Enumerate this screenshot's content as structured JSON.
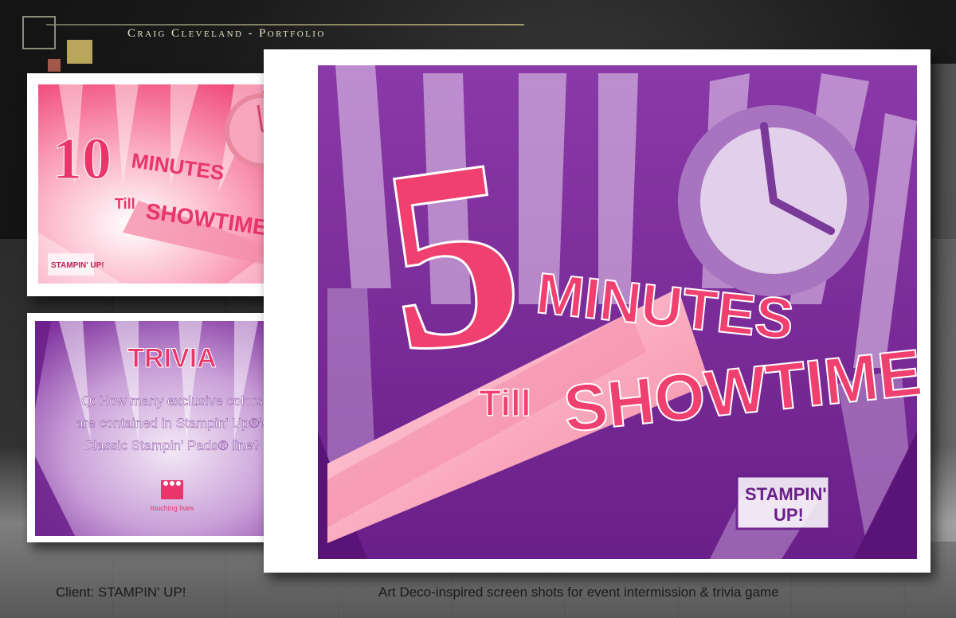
{
  "header": {
    "title": "Craig Cleveland - Portfolio"
  },
  "slides": {
    "countdown_small": {
      "number": "10",
      "word1": "MINUTES",
      "word2": "Till",
      "word3": "SHOWTIME",
      "logo": "STAMPIN' UP!"
    },
    "trivia": {
      "title": "TRIVIA",
      "question_lines": [
        "Q: How many exclusive colors",
        "are contained in Stampin' Up®'s",
        "Classic Stampin' Pads® line?"
      ],
      "logo": "touching lives"
    },
    "countdown_large": {
      "number": "5",
      "word1": "MINUTES",
      "word2": "Till",
      "word3": "SHOWTIME",
      "logo_line1": "STAMPIN'",
      "logo_line2": "UP!"
    }
  },
  "captions": {
    "client": "Client: STAMPIN' UP!",
    "description": "Art Deco-inspired screen shots for event intermission & trivia game"
  },
  "colors": {
    "pink": "#f04070",
    "purple": "#7a2a9a",
    "gold": "#b8a65a",
    "rust": "#a2584a"
  }
}
